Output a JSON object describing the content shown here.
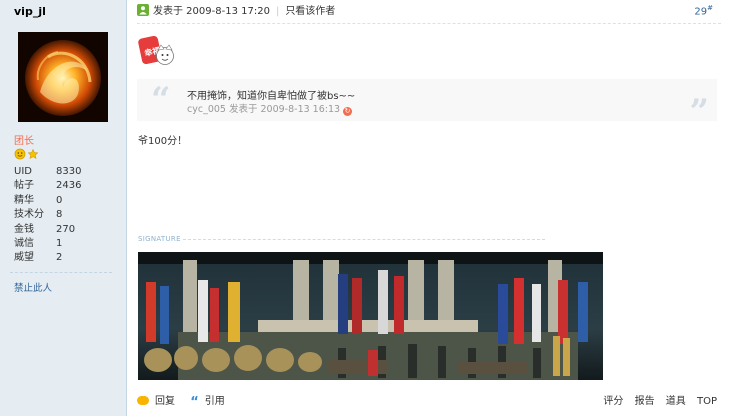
{
  "author": {
    "username": "vip_jl",
    "rank": "团长",
    "stats": [
      {
        "label": "UID",
        "value": "8330"
      },
      {
        "label": "帖子",
        "value": "2436"
      },
      {
        "label": "精华",
        "value": "0"
      },
      {
        "label": "技术分",
        "value": "8"
      },
      {
        "label": "金钱",
        "value": "270"
      },
      {
        "label": "诚信",
        "value": "1"
      },
      {
        "label": "威望",
        "value": "2"
      }
    ],
    "ban_link": "禁止此人"
  },
  "post": {
    "posted_label": "发表于 2009-8-13 17:20",
    "only_author": "只看该作者",
    "floor": "29",
    "floor_mark": "#",
    "emoticon_text": "幸福",
    "quote": {
      "text": "不用掩饰，知道你自卑怕做了被bs~~",
      "meta": "cyc_005 发表于 2009-8-13 16:13"
    },
    "message": "爷100分！",
    "signature_label": "SIGNATURE"
  },
  "footer": {
    "reply": "回复",
    "quote": "引用",
    "rate": "评分",
    "report": "报告",
    "tools": "道具",
    "top": "TOP"
  }
}
